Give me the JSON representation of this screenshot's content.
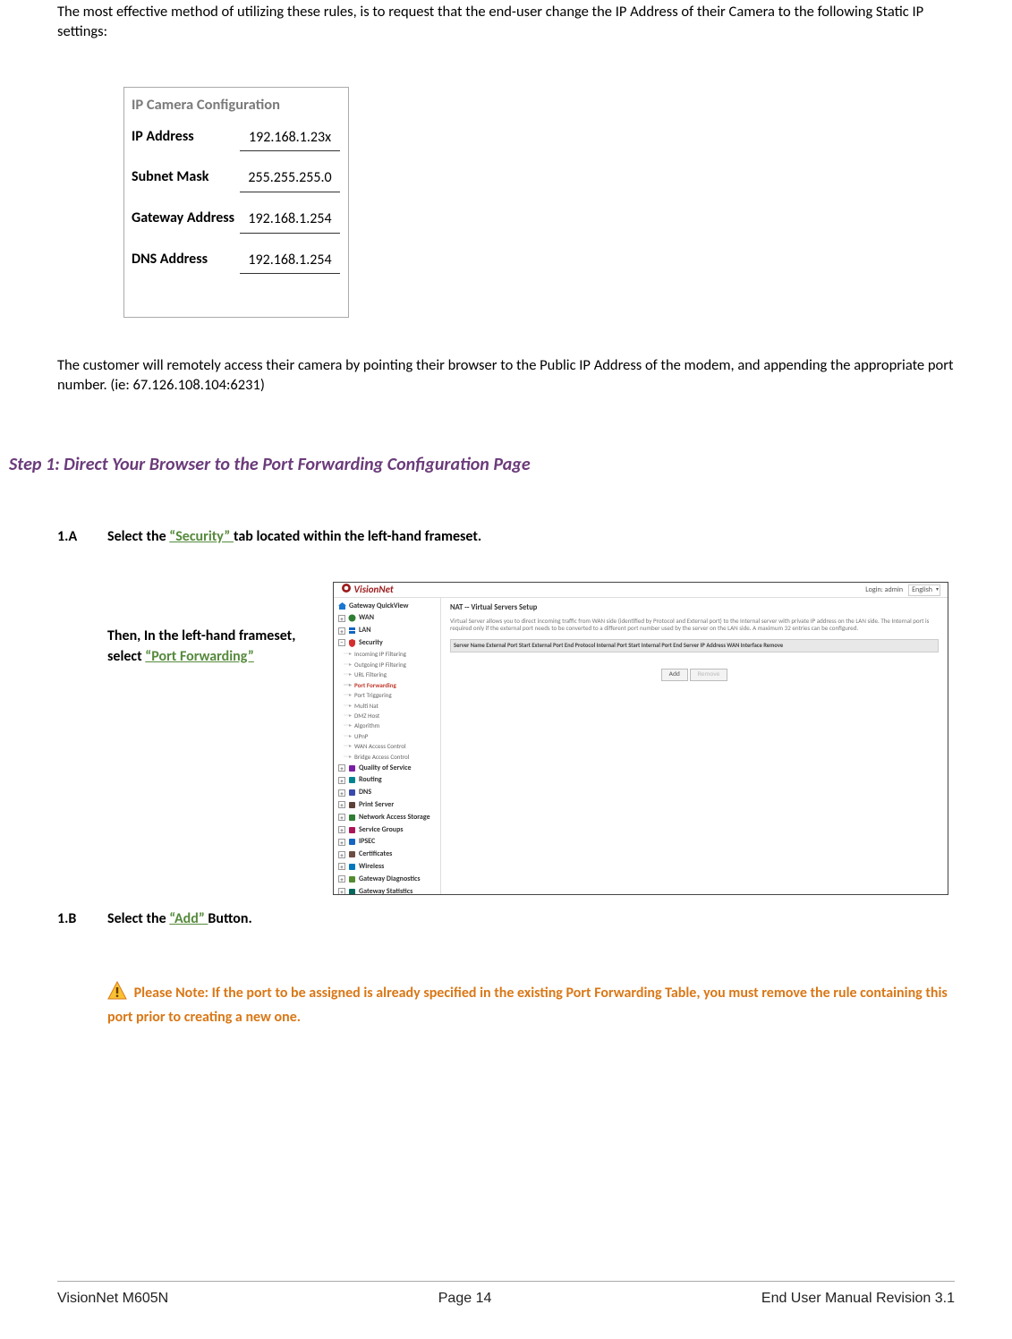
{
  "intro": "The most effective method of utilizing these rules, is to request that the end-user change the IP Address of their Camera to the following Static IP settings:",
  "config_table": {
    "title": "IP Camera Configuration",
    "rows": [
      {
        "label": "IP Address",
        "value": "192.168.1.23x"
      },
      {
        "label": "Subnet Mask",
        "value": "255.255.255.0"
      },
      {
        "label": "Gateway Address",
        "value": "192.168.1.254"
      },
      {
        "label": "DNS Address",
        "value": "192.168.1.254"
      }
    ]
  },
  "para2": "The customer will remotely access their camera by pointing their browser to the Public IP Address of the modem, and appending the appropriate port number. (ie: 67.126.108.104:6231)",
  "step_heading": "Step 1: Direct Your Browser to the Port Forwarding Configuration Page",
  "step_1a": {
    "num": "1.A",
    "pre": "Select the ",
    "link": "“Security” ",
    "post": "tab located within the left-hand frameset."
  },
  "mid_text": {
    "line1": "Then, In the left-hand frameset, select ",
    "link": "“Port Forwarding”"
  },
  "screenshot": {
    "logo": "VisionNet",
    "login_label": "Login: admin",
    "lang": "English",
    "side_top": "Gateway QuickView",
    "side_items": [
      {
        "label": "WAN",
        "icon_color": "#2e7d32"
      },
      {
        "label": "LAN",
        "icon_color": "#1565c0"
      },
      {
        "label": "Security",
        "icon_color": "#d32f2f",
        "expanded": true
      }
    ],
    "security_subs": [
      "Incoming IP Filtering",
      "Outgoing IP Filtering",
      "URL Filtering",
      "Port Forwarding",
      "Port Triggering",
      "Multi Nat",
      "DMZ Host",
      "Algorithm",
      "UPnP",
      "WAN Access Control",
      "Bridge Access Control"
    ],
    "side_bottom": [
      {
        "label": "Quality of Service"
      },
      {
        "label": "Routing"
      },
      {
        "label": "DNS"
      },
      {
        "label": "Print Server"
      },
      {
        "label": "Network Access Storage"
      },
      {
        "label": "Service Groups"
      },
      {
        "label": "IPSEC"
      },
      {
        "label": "Certificates"
      },
      {
        "label": "Wireless"
      },
      {
        "label": "Gateway Diagnostics"
      },
      {
        "label": "Gateway Statistics"
      }
    ],
    "main_title": "NAT -- Virtual Servers Setup",
    "main_desc": "Virtual Server allows you to direct incoming traffic from WAN side (identified by Protocol and External port) to the Internal server with private IP address on the LAN side. The Internal port is required only if the external port needs to be converted to a different port number used by the server on the LAN side. A maximum 32 entries can be configured.",
    "table_header": "Server Name  External Port Start  External Port End  Protocol  Internal Port Start  Internal Port End  Server IP Address  WAN Interface  Remove",
    "btn_add": "Add",
    "btn_remove": "Remove"
  },
  "step_1b": {
    "num": "1.B",
    "pre": "Select the ",
    "link": "“Add” ",
    "post": "Button."
  },
  "note": {
    "pre": " Please Note: If the port to be assigned is already specified in the existing Port Forwarding Table, you must remove the rule containing this port prior to creating a new one."
  },
  "footer": {
    "left": "VisionNet M605N",
    "center": "Page 14",
    "right": "End User Manual Revision 3.1"
  }
}
